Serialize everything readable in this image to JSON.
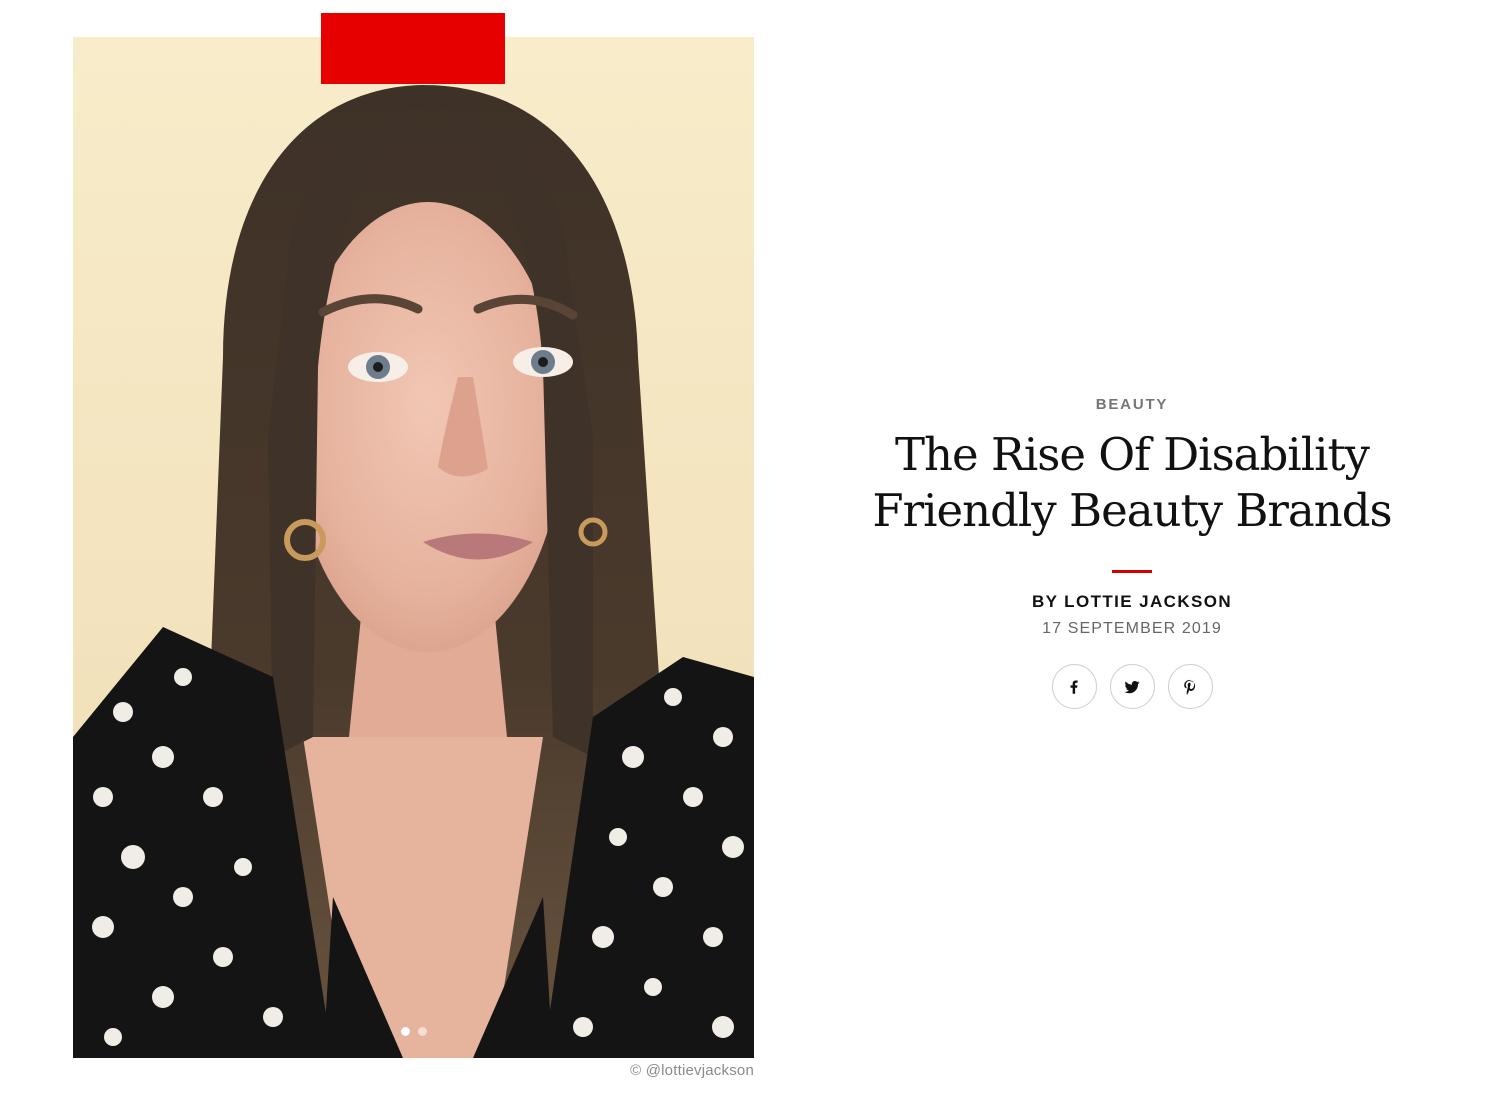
{
  "photo": {
    "alt_subject": "portrait photo",
    "credit": "© @lottievjackson",
    "carousel": {
      "count": 2,
      "active_index": 0
    }
  },
  "article": {
    "category": "BEAUTY",
    "title_line1": "The Rise Of Disability",
    "title_line2": "Friendly Beauty Brands",
    "byline": "BY LOTTIE JACKSON",
    "date": "17 SEPTEMBER 2019"
  },
  "share": {
    "icons": [
      "facebook-icon",
      "twitter-icon",
      "pinterest-icon"
    ]
  },
  "colors": {
    "accent": "#d40000",
    "badge": "#e60000",
    "text": "#111111",
    "muted": "#767676"
  }
}
